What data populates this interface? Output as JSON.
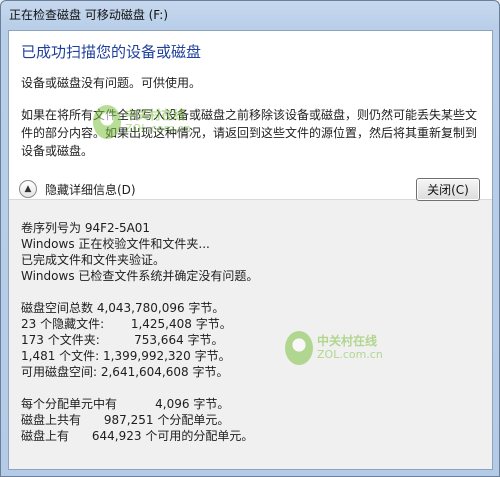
{
  "window": {
    "title": "正在检查磁盘 可移动磁盘 (F:)"
  },
  "header": {
    "heading": "已成功扫描您的设备或磁盘",
    "status": "设备或磁盘没有问题。可供使用。",
    "warning": "如果在将所有文件全部写入设备或磁盘之前移除该设备或磁盘，则仍然可能丢失某些文件的部分内容。如果出现这种情况，请返回到这些文件的源位置，然后将其重新复制到设备或磁盘。"
  },
  "controls": {
    "details_label": "隐藏详细信息(D)",
    "close_label": "关闭(C)"
  },
  "details": {
    "group1": [
      "卷序列号为 94F2-5A01",
      "Windows 正在校验文件和文件夹...",
      "已完成文件和文件夹验证。",
      "Windows 已检查文件系统并确定没有问题。"
    ],
    "group2": [
      "磁盘空间总数 4,043,780,096 字节。",
      "23 个隐藏文件:       1,425,408 字节。",
      "173 个文件夹:         753,664 字节。",
      "1,481 个文件: 1,399,992,320 字节。",
      "可用磁盘空间: 2,641,604,608 字节。"
    ],
    "group3": [
      "每个分配单元中有          4,096 字节。",
      "磁盘上共有      987,251 个分配单元。",
      "磁盘上有      644,923 个可用的分配单元。"
    ]
  },
  "watermarks": [
    {
      "text": "中关村在线",
      "url": "ZOL.com.cn"
    },
    {
      "text": "中关村在线",
      "url": "ZOL.com.cn"
    }
  ]
}
